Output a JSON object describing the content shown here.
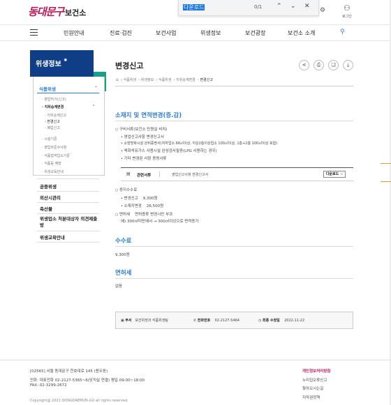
{
  "header": {
    "logo": "동대문구",
    "title": "보건소",
    "find": {
      "query": "다운로드",
      "count": "0/1"
    },
    "login_label": "로그인"
  },
  "gnb": [
    "민원안내",
    "진료·검진",
    "보건사업",
    "위생정보",
    "보건광장",
    "보건소 소개"
  ],
  "sidebar": {
    "heading": "위생정보",
    "active_l1": "식품위생",
    "items_l2_top": [
      "영업허가(신고)",
      "지위승계변경"
    ],
    "items_l3": [
      "지위승계신고",
      "변경신고",
      "폐업신고"
    ],
    "items_l2_bottom": [
      "시설기준",
      "영업자준수사항",
      "식품접객업소기준",
      "식품등 예방",
      "위생교육안내"
    ],
    "items_l1": [
      "공중위생",
      "외산시관리",
      "축산물",
      "위생업소 처분대상자 의견제출방",
      "위생교육안내"
    ]
  },
  "content": {
    "title": "변경신고",
    "breadcrumb": [
      "식품위생",
      "위생정보",
      "식품위생",
      "지위승계변경",
      "변경신고"
    ],
    "section1_title": "소재지 및 면적변경(증.감)",
    "docs_heading": "구비서류(보건소 민원실 비치)",
    "docs": [
      "영업신고사항 변경신고서",
      "소방방화시설 완비증명서(지하업소 66㎡이상, 지상2층이상업소 100㎡이상, 1층+2층 100㎡이상 포함)",
      "액화석유가스 사용시설 완성검사필증(LPG 사용하는 경우)",
      "기타 변경된 사항 증명서류"
    ],
    "ref_label": "관련서류",
    "ref_file": "영업신고사항 변경신고서",
    "download": "다운로드",
    "fee_heading": "증지수수료",
    "fees": [
      "변경신고    9,300원",
      "소재지변경    26,500원"
    ],
    "license_heading": "면허세    면허종류 변경시만 부과",
    "license_example": "예) 300㎡미만에서 → 300㎡이상으로 면적증가",
    "section2_title": "수수료",
    "section2_body": "9,300원",
    "section3_title": "면허세",
    "section3_body": "없음"
  },
  "info": {
    "dept_key": "부서",
    "dept_val": "보건위생과 식품위생팀",
    "tel_key": "전화번호",
    "tel_val": "02-2127-5464",
    "date_key": "최종 수정일",
    "date_val": "2022-11-22"
  },
  "footer": {
    "address": "[02565] 서울 동대문구 천호대로 145 (용두동)",
    "phone": "전화: 대표전화 02-2127-5365~6(당직실 연결) 평일 09:00~18:00",
    "fax": "FAX: 02-3299-2672",
    "copyright": "Copyright@ 2021 DONGDAEMUN-GU all rights reserved.",
    "links": [
      "개인정보처리방침",
      "누리집오류신고",
      "찾아오시는길",
      "저작권정책"
    ]
  }
}
